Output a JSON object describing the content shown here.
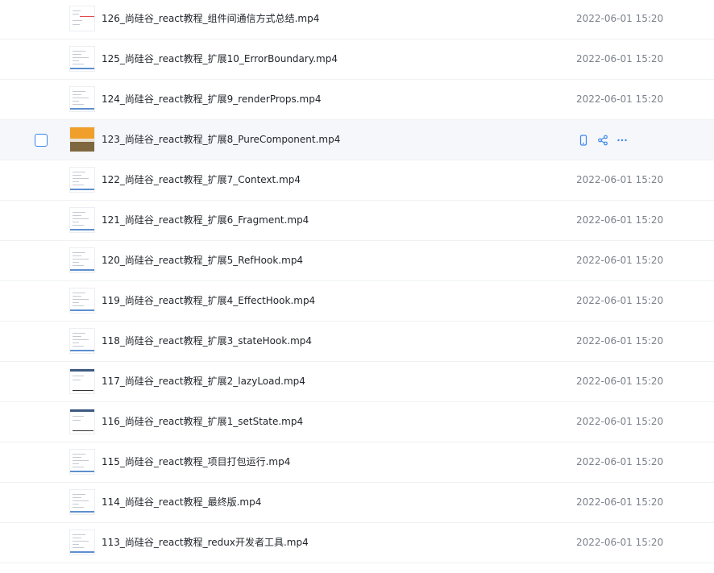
{
  "colors": {
    "accent": "#3a86e8",
    "hover_row": "#f5f7fb",
    "divider": "#f0f1f3"
  },
  "files": [
    {
      "name": "126_尚硅谷_react教程_组件间通信方式总结.mp4",
      "time": "2022-06-01 15:20",
      "thumb": "redline"
    },
    {
      "name": "125_尚硅谷_react教程_扩展10_ErrorBoundary.mp4",
      "time": "2022-06-01 15:20",
      "thumb": "doc"
    },
    {
      "name": "124_尚硅谷_react教程_扩展9_renderProps.mp4",
      "time": "2022-06-01 15:20",
      "thumb": "doc"
    },
    {
      "name": "123_尚硅谷_react教程_扩展8_PureComponent.mp4",
      "time": "2022-06-01 15:20",
      "thumb": "orange",
      "hovered": true
    },
    {
      "name": "122_尚硅谷_react教程_扩展7_Context.mp4",
      "time": "2022-06-01 15:20",
      "thumb": "doc"
    },
    {
      "name": "121_尚硅谷_react教程_扩展6_Fragment.mp4",
      "time": "2022-06-01 15:20",
      "thumb": "doc"
    },
    {
      "name": "120_尚硅谷_react教程_扩展5_RefHook.mp4",
      "time": "2022-06-01 15:20",
      "thumb": "doc"
    },
    {
      "name": "119_尚硅谷_react教程_扩展4_EffectHook.mp4",
      "time": "2022-06-01 15:20",
      "thumb": "doc"
    },
    {
      "name": "118_尚硅谷_react教程_扩展3_stateHook.mp4",
      "time": "2022-06-01 15:20",
      "thumb": "doc"
    },
    {
      "name": "117_尚硅谷_react教程_扩展2_lazyLoad.mp4",
      "time": "2022-06-01 15:20",
      "thumb": "dark"
    },
    {
      "name": "116_尚硅谷_react教程_扩展1_setState.mp4",
      "time": "2022-06-01 15:20",
      "thumb": "dark"
    },
    {
      "name": "115_尚硅谷_react教程_项目打包运行.mp4",
      "time": "2022-06-01 15:20",
      "thumb": "doc"
    },
    {
      "name": "114_尚硅谷_react教程_最终版.mp4",
      "time": "2022-06-01 15:20",
      "thumb": "doc"
    },
    {
      "name": "113_尚硅谷_react教程_redux开发者工具.mp4",
      "time": "2022-06-01 15:20",
      "thumb": "doc"
    }
  ],
  "row_actions": [
    {
      "icon": "phone-icon"
    },
    {
      "icon": "share-icon"
    },
    {
      "icon": "more-icon"
    }
  ]
}
